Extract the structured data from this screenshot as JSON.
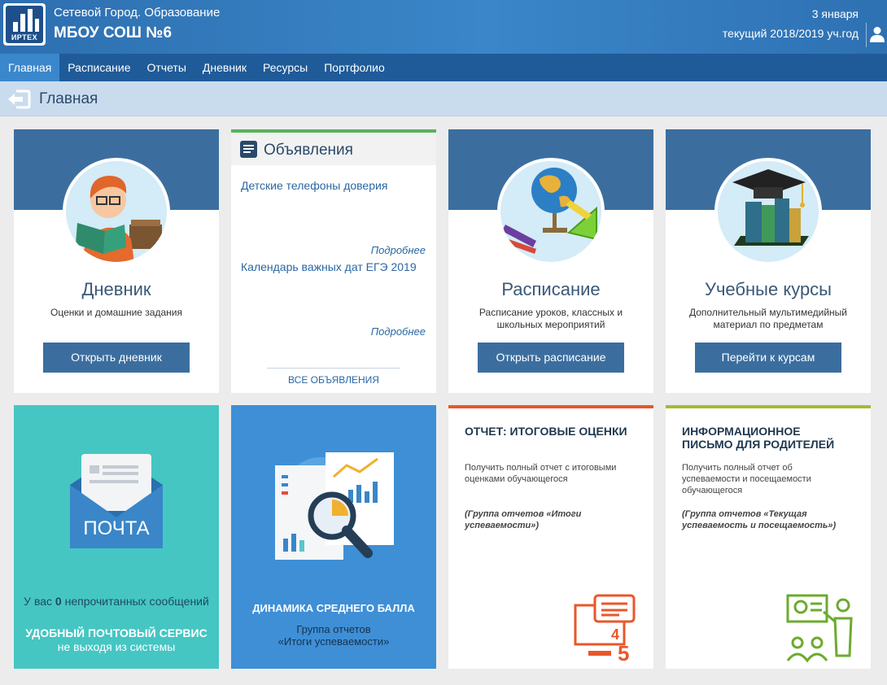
{
  "header": {
    "org_subtitle": "Сетевой Город. Образование",
    "org_name": "МБОУ СОШ №6",
    "logo_text": "ИРТЕХ",
    "date": "3 января",
    "school_year": "текущий 2018/2019 уч.год"
  },
  "nav": {
    "items": [
      "Главная",
      "Расписание",
      "Отчеты",
      "Дневник",
      "Ресурсы",
      "Портфолио"
    ],
    "active_index": 0
  },
  "breadcrumb": {
    "title": "Главная"
  },
  "tiles": {
    "diary": {
      "title": "Дневник",
      "description": "Оценки и домашние задания",
      "button": "Открыть дневник"
    },
    "announcements": {
      "title": "Объявления",
      "items": [
        {
          "title": "Детские телефоны доверия",
          "more": "Подробнее"
        },
        {
          "title": "Календарь важных дат ЕГЭ 2019",
          "more": "Подробнее"
        }
      ],
      "all_link": "ВСЕ ОБЪЯВЛЕНИЯ"
    },
    "schedule": {
      "title": "Расписание",
      "description": "Расписание уроков, классных и школьных мероприятий",
      "button": "Открыть расписание"
    },
    "courses": {
      "title": "Учебные курсы",
      "description": "Дополнительный мультимедийный материал по предметам",
      "button": "Перейти к курсам"
    },
    "mail": {
      "envelope_label": "ПОЧТА",
      "unread_prefix": "У вас",
      "unread_count": "0",
      "unread_suffix": "непрочитанных сообщений",
      "feature_title": "УДОБНЫЙ ПОЧТОВЫЙ СЕРВИС",
      "feature_sub": "не выходя из системы"
    },
    "dynamics": {
      "title": "ДИНАМИКА СРЕДНЕГО БАЛЛА",
      "subtitle_1": "Группа отчетов",
      "subtitle_2": "«Итоги успеваемости»"
    },
    "report_final": {
      "title": "ОТЧЕТ: ИТОГОВЫЕ ОЦЕНКИ",
      "description": "Получить полный отчет с итоговыми оценками обучающегося",
      "group": "(Группа отчетов «Итоги успеваемости»)",
      "icon_digits": [
        "4",
        "5"
      ]
    },
    "report_letter": {
      "title": "ИНФОРМАЦИОННОЕ ПИСЬМО ДЛЯ РОДИТЕЛЕЙ",
      "description": "Получить полный отчет об успеваемости и посещаемости обучающегося",
      "group": "(Группа отчетов «Текущая успеваемость и посещаемость»)"
    }
  },
  "colors": {
    "header": "#2d6fb0",
    "nav": "#1f5b99",
    "nav_active": "#3b87cc",
    "tile_band": "#3b6e9f",
    "mail_tile": "#45c6c3",
    "dynamics_tile": "#3e8fd6",
    "report_orange": "#e9572b",
    "report_green": "#a6b932",
    "announcements_accent": "#55b35a"
  }
}
